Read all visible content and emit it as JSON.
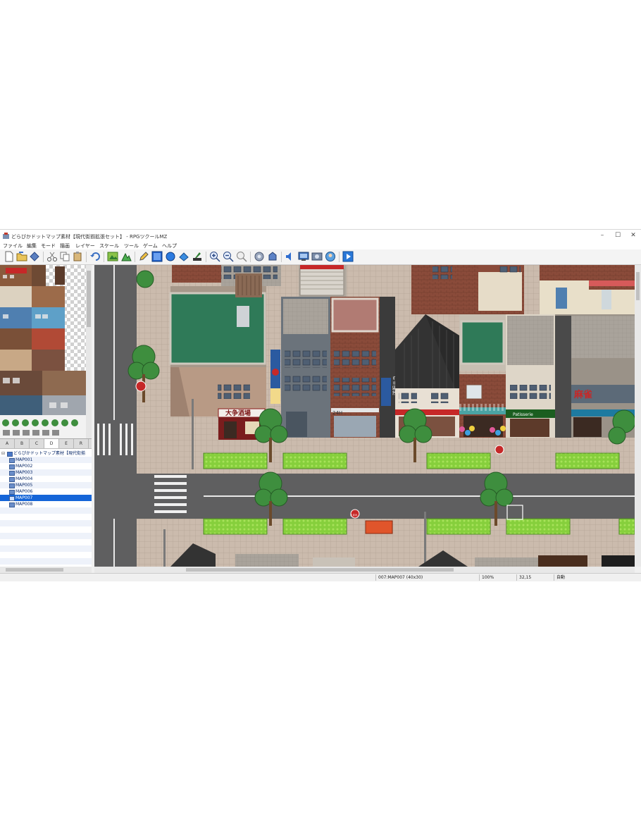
{
  "window": {
    "title": "どらぴかドットマップ素材【現代街揃拡張セット】 - RPGツクールMZ",
    "minimize": "–",
    "maximize": "☐",
    "close": "✕"
  },
  "menu": [
    "ファイル",
    "編集",
    "モード",
    "描画",
    "レイヤー",
    "スケール",
    "ツール",
    "ゲーム",
    "ヘルプ"
  ],
  "toolbar_icons": [
    "new-icon",
    "open-icon",
    "save-icon",
    "cut-icon",
    "copy-icon",
    "paste-icon",
    "undo-icon",
    "map-mode-icon",
    "event-mode-icon",
    "pencil-icon",
    "rectangle-icon",
    "ellipse-icon",
    "fill-icon",
    "shadow-pen-icon",
    "zoom-in-icon",
    "zoom-out-icon",
    "zoom-reset-icon",
    "database-icon",
    "plugin-icon",
    "sound-test-icon",
    "event-search-icon",
    "resource-manager-icon",
    "character-generator-icon",
    "playtest-icon"
  ],
  "palette": {
    "tabs": [
      "A",
      "B",
      "C",
      "D",
      "E",
      "R"
    ],
    "active_tab": "D"
  },
  "map_tree": {
    "project": "どらぴかドットマップ素材【現代街揃",
    "maps": [
      "MAP001",
      "MAP002",
      "MAP003",
      "MAP004",
      "MAP005",
      "MAP006",
      "MAP007",
      "MAP008"
    ],
    "selected": "MAP007"
  },
  "map_signs": {
    "sake_shop": "大争酒場",
    "mahjong": "麻雀",
    "patisserie": "Patisserie",
    "hours": "24H",
    "vertical_sign": "洋服テラ",
    "stop": "止まれ"
  },
  "status": {
    "map": "007:MAP007 (40x30)",
    "zoom": "100%",
    "coords": "32,15",
    "mode": "自動"
  },
  "colors": {
    "selection": "#1565d8",
    "road": "#5f5f60",
    "sidewalk": "#c9b8a8",
    "grass": "#8fd24a",
    "roof_green": "#2f7a58"
  }
}
